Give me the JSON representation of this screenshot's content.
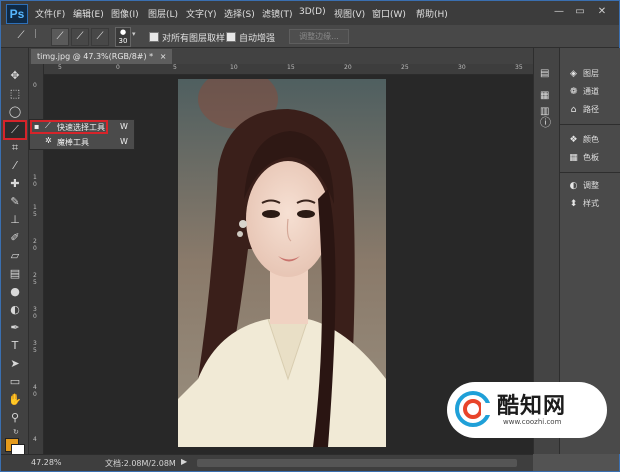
{
  "app": {
    "logo": "Ps"
  },
  "menu": [
    "文件(F)",
    "编辑(E)",
    "图像(I)",
    "图层(L)",
    "文字(Y)",
    "选择(S)",
    "滤镜(T)",
    "3D(D)",
    "视图(V)",
    "窗口(W)",
    "帮助(H)"
  ],
  "window_controls": {
    "minimize": "—",
    "restore": "▭",
    "close": "✕"
  },
  "options": {
    "brush_size": "30",
    "sample_all_layers": "对所有图层取样",
    "auto_enhance": "自动增强",
    "refine_edge": "调整边缘..."
  },
  "document": {
    "tab_title": "timg.jpg @ 47.3%(RGB/8#) *",
    "close": "×"
  },
  "ruler": {
    "h_ticks": [
      "5",
      "0",
      "5",
      "10",
      "15",
      "20",
      "25",
      "30",
      "35"
    ],
    "v_ticks": [
      "0",
      "5",
      "1",
      "0",
      "1",
      "5",
      "2",
      "0",
      "2",
      "5",
      "3",
      "0",
      "3",
      "5",
      "4",
      "0",
      "4"
    ]
  },
  "flyout": {
    "items": [
      {
        "label": "快速选择工具",
        "shortcut": "W",
        "selected": true
      },
      {
        "label": "魔棒工具",
        "shortcut": "W",
        "selected": false
      }
    ]
  },
  "status": {
    "zoom": "47.28%",
    "doc_size": "文档:2.08M/2.08M"
  },
  "panels": [
    {
      "icon": "layers-icon",
      "label": "图层"
    },
    {
      "icon": "channels-icon",
      "label": "通道"
    },
    {
      "icon": "paths-icon",
      "label": "路径"
    },
    {
      "icon": "color-icon",
      "label": "颜色"
    },
    {
      "icon": "swatches-icon",
      "label": "色板"
    },
    {
      "icon": "adjustments-icon",
      "label": "调整"
    },
    {
      "icon": "styles-icon",
      "label": "样式"
    }
  ],
  "watermark": {
    "title": "酷知网",
    "url": "www.coozhi.com"
  },
  "colors": {
    "foreground": "#e49a1c",
    "background": "#ffffff",
    "highlight": "#d6242a"
  }
}
